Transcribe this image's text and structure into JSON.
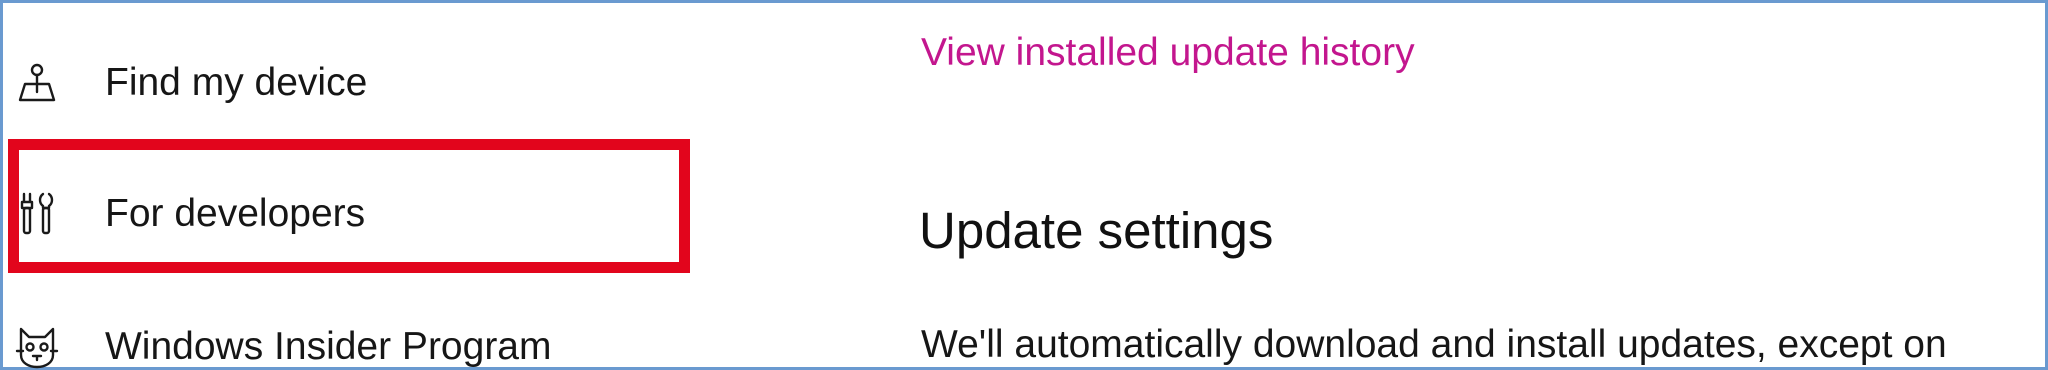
{
  "nav": {
    "items": [
      {
        "label": "Find my device",
        "icon": "find-device-icon"
      },
      {
        "label": "For developers",
        "icon": "developer-tools-icon"
      },
      {
        "label": "Windows Insider Program",
        "icon": "insider-cat-icon"
      }
    ]
  },
  "main": {
    "history_link": "View installed update history",
    "section_title": "Update settings",
    "description": "We'll automatically download and install updates, except on"
  },
  "colors": {
    "link": "#c3168e",
    "highlight": "#e2051c",
    "frame_border": "#6a9ad0"
  }
}
